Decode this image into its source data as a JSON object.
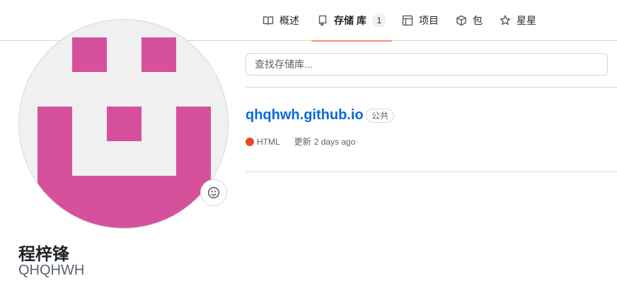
{
  "nav": {
    "tabs": [
      {
        "label": "概述",
        "icon": "book-icon"
      },
      {
        "label": "存储 库",
        "icon": "repo-icon",
        "count": "1",
        "active": true
      },
      {
        "label": "项目",
        "icon": "table-icon"
      },
      {
        "label": "包",
        "icon": "package-icon"
      },
      {
        "label": "星星",
        "icon": "star-icon"
      }
    ],
    "accent_color": "#fd8c73"
  },
  "profile": {
    "full_name": "程梓锋",
    "username": "QHQHWH",
    "avatar_color": "#d6509c"
  },
  "search": {
    "placeholder": "查找存储库...",
    "value": ""
  },
  "repos": [
    {
      "name": "qhqhwh.github.io",
      "visibility": "公共",
      "language": "HTML",
      "language_color": "#e34c26",
      "updated_label": "更新",
      "updated_time": "2 days ago"
    }
  ]
}
